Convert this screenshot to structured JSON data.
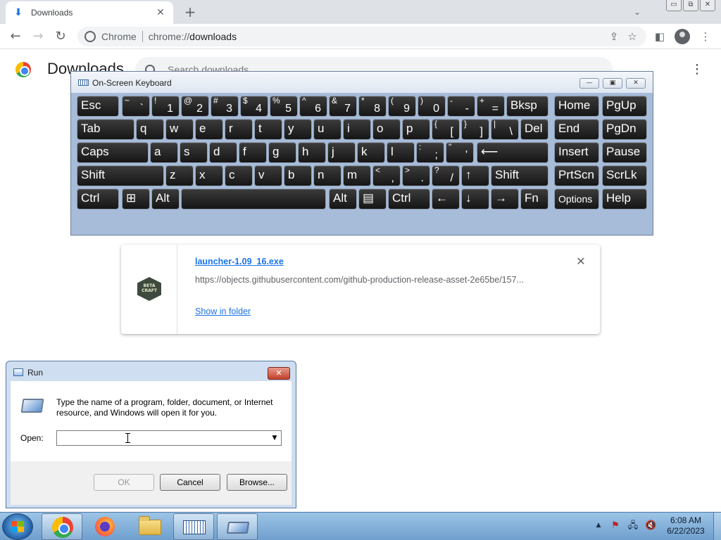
{
  "browser": {
    "tab_title": "Downloads",
    "tab_icon": "download-icon",
    "tab_close_glyph": "✕",
    "new_tab_glyph": "+",
    "omnibox_label": "Chrome",
    "omnibox_url_scheme": "chrome://",
    "omnibox_url_path": "downloads",
    "window_controls": [
      "▭",
      "⧉",
      "✕"
    ]
  },
  "downloads_page": {
    "title": "Downloads",
    "search_placeholder": "Search downloads",
    "menu_glyph": "⋮",
    "item": {
      "file_name": "launcher-1.09_16.exe",
      "url": "https://objects.githubusercontent.com/github-production-release-asset-2e65be/157...",
      "show_in_folder": "Show in folder",
      "icon_text": "BETA CRAFT",
      "close_glyph": "✕"
    }
  },
  "osk": {
    "title": "On-Screen Keyboard",
    "window_controls": [
      "—",
      "▣",
      "✕"
    ],
    "rows": [
      [
        {
          "main": "Esc"
        },
        {
          "sec": "~",
          "pri": "`"
        },
        {
          "sec": "!",
          "pri": "1"
        },
        {
          "sec": "@",
          "pri": "2"
        },
        {
          "sec": "#",
          "pri": "3"
        },
        {
          "sec": "$",
          "pri": "4"
        },
        {
          "sec": "%",
          "pri": "5"
        },
        {
          "sec": "^",
          "pri": "6"
        },
        {
          "sec": "&",
          "pri": "7"
        },
        {
          "sec": "*",
          "pri": "8"
        },
        {
          "sec": "(",
          "pri": "9"
        },
        {
          "sec": ")",
          "pri": "0"
        },
        {
          "sec": "-",
          "pri": "-"
        },
        {
          "sec": "+",
          "pri": "="
        },
        {
          "main": "Bksp"
        },
        {
          "main": "Home"
        },
        {
          "main": "PgUp"
        }
      ],
      [
        {
          "main": "Tab"
        },
        {
          "main": "q"
        },
        {
          "main": "w"
        },
        {
          "main": "e"
        },
        {
          "main": "r"
        },
        {
          "main": "t"
        },
        {
          "main": "y"
        },
        {
          "main": "u"
        },
        {
          "main": "i"
        },
        {
          "main": "o"
        },
        {
          "main": "p"
        },
        {
          "sec": "{",
          "pri": "["
        },
        {
          "sec": "}",
          "pri": "]"
        },
        {
          "sec": "|",
          "pri": "\\"
        },
        {
          "main": "Del"
        },
        {
          "main": "End"
        },
        {
          "main": "PgDn"
        }
      ],
      [
        {
          "main": "Caps"
        },
        {
          "main": "a"
        },
        {
          "main": "s"
        },
        {
          "main": "d"
        },
        {
          "main": "f"
        },
        {
          "main": "g"
        },
        {
          "main": "h"
        },
        {
          "main": "j"
        },
        {
          "main": "k"
        },
        {
          "main": "l"
        },
        {
          "sec": ":",
          "pri": ";"
        },
        {
          "sec": "\"",
          "pri": "'"
        },
        {
          "main": "⟵"
        },
        {
          "main": "Insert"
        },
        {
          "main": "Pause"
        }
      ],
      [
        {
          "main": "Shift"
        },
        {
          "main": "z"
        },
        {
          "main": "x"
        },
        {
          "main": "c"
        },
        {
          "main": "v"
        },
        {
          "main": "b"
        },
        {
          "main": "n"
        },
        {
          "main": "m"
        },
        {
          "sec": "<",
          "pri": ","
        },
        {
          "sec": ">",
          "pri": "."
        },
        {
          "sec": "?",
          "pri": "/"
        },
        {
          "main": "↑"
        },
        {
          "main": "Shift"
        },
        {
          "main": "PrtScn"
        },
        {
          "main": "ScrLk"
        }
      ],
      [
        {
          "main": "Ctrl"
        },
        {
          "main": "⊞"
        },
        {
          "main": "Alt"
        },
        {
          "main": ""
        },
        {
          "main": "Alt"
        },
        {
          "main": "▤"
        },
        {
          "main": "Ctrl"
        },
        {
          "main": "←"
        },
        {
          "main": "↓"
        },
        {
          "main": "→"
        },
        {
          "main": "Fn"
        },
        {
          "main": "Options"
        },
        {
          "main": "Help"
        }
      ]
    ]
  },
  "run_dialog": {
    "title": "Run",
    "close_glyph": "✕",
    "description": "Type the name of a program, folder, document, or Internet resource, and Windows will open it for you.",
    "open_label": "Open:",
    "open_value": "",
    "ok_label": "OK",
    "cancel_label": "Cancel",
    "browse_label": "Browse..."
  },
  "taskbar": {
    "time": "6:08 AM",
    "date": "6/22/2023",
    "tray_arrow": "▲",
    "tray_icons": [
      "⚑",
      "🖧",
      "🔇"
    ]
  }
}
